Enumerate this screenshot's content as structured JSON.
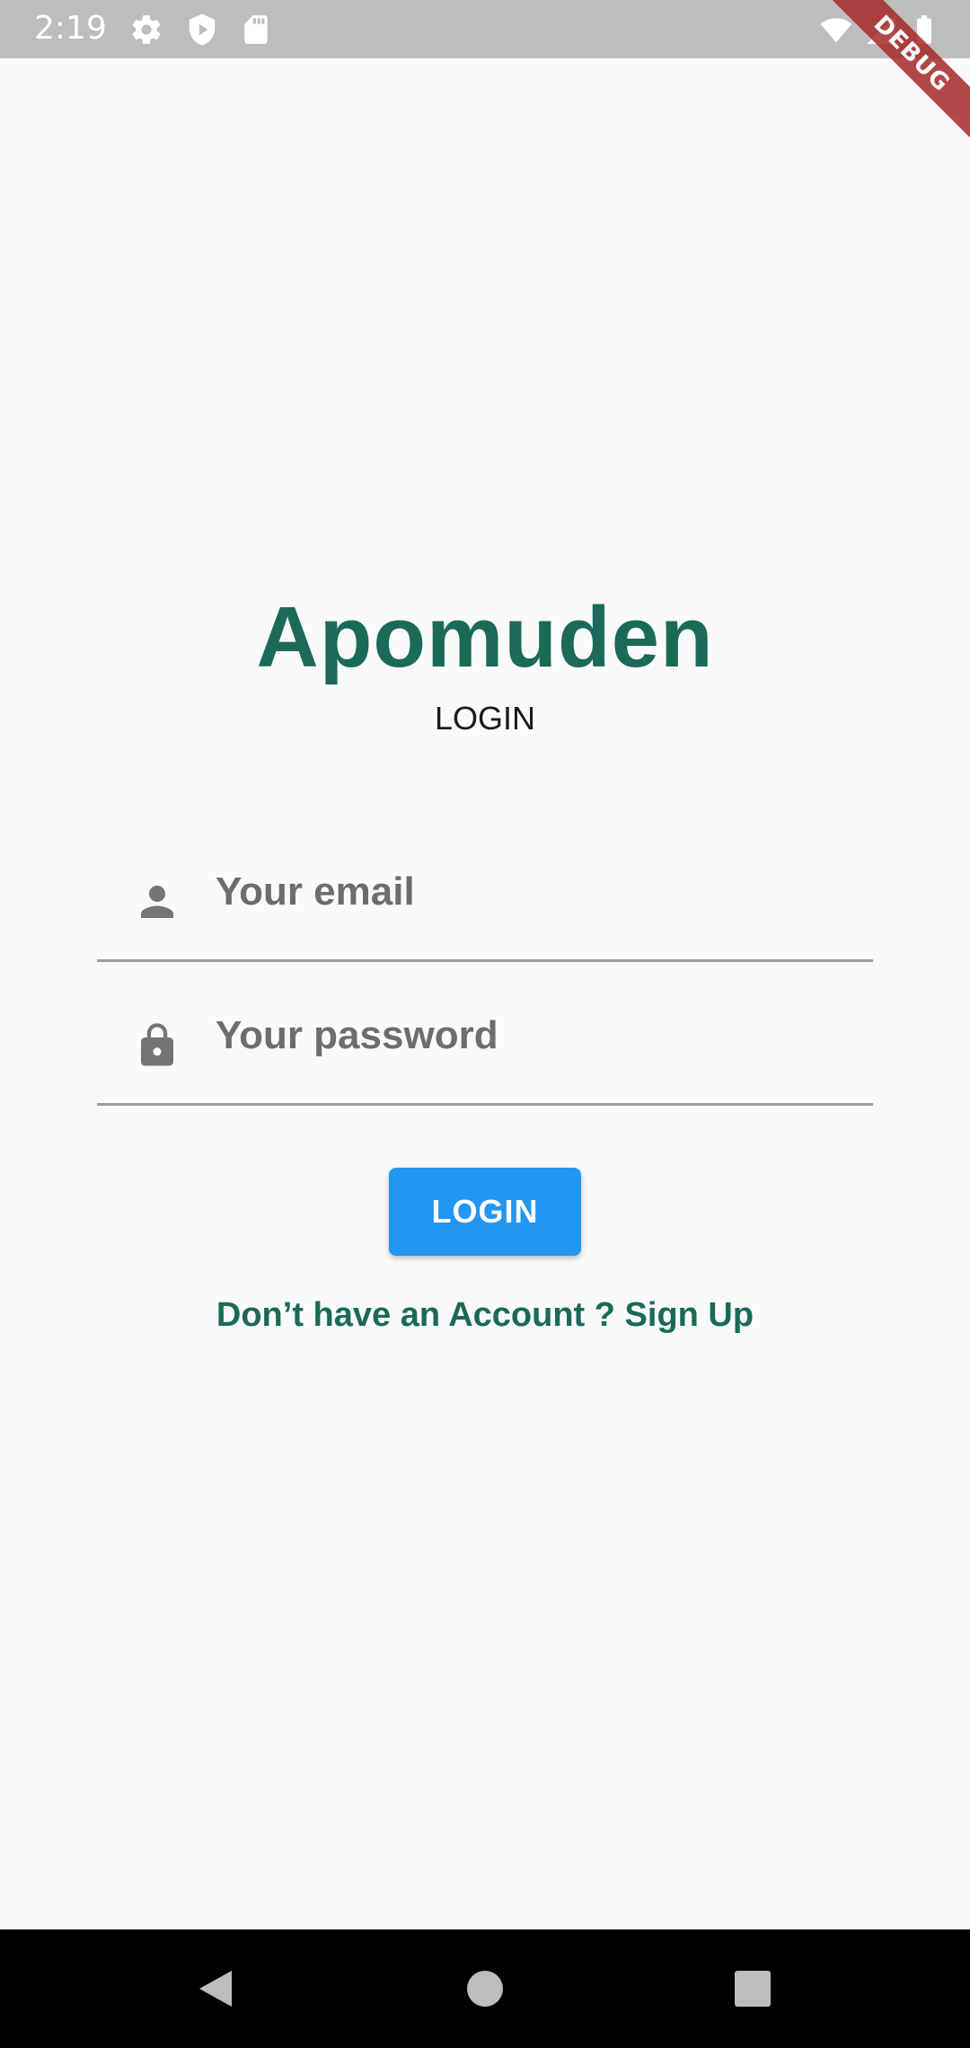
{
  "status_bar": {
    "time": "2:19",
    "icons": [
      "gear-icon",
      "shield-play-icon",
      "sd-card-icon",
      "wifi-icon",
      "signal-icon",
      "battery-icon"
    ]
  },
  "debug_banner": {
    "label": "DEBUG",
    "color": "#a52a2a"
  },
  "app": {
    "title": "Apomuden",
    "subtitle": "LOGIN",
    "accent_color": "#1a6a57"
  },
  "form": {
    "email": {
      "icon": "person-icon",
      "placeholder": "Your email",
      "value": ""
    },
    "password": {
      "icon": "lock-icon",
      "placeholder": "Your password",
      "value": ""
    },
    "login_button": {
      "label": "LOGIN",
      "color": "#2196f3"
    }
  },
  "signup_prompt": {
    "text": "Don’t have an Account ? ",
    "link": "Sign Up"
  },
  "nav_bar": {
    "buttons": [
      "back-icon",
      "home-icon",
      "recents-icon"
    ]
  }
}
